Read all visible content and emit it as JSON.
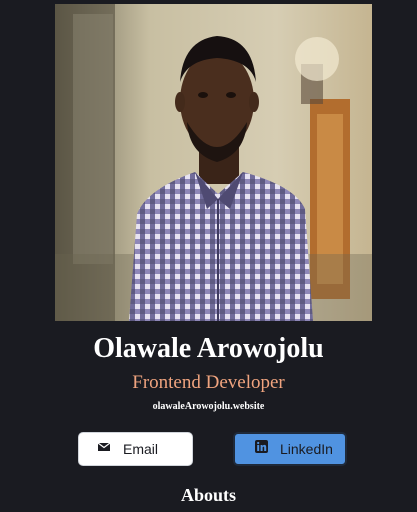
{
  "profile": {
    "photo_alt": "Portrait photo",
    "name": "Olawale Arowojolu",
    "role": "Frontend Developer",
    "website": "olawaleArowojolu.website"
  },
  "buttons": {
    "email": {
      "label": "Email",
      "icon": "envelope-icon"
    },
    "linkedin": {
      "label": "LinkedIn",
      "icon": "linkedin-icon"
    }
  },
  "sections": {
    "abouts_heading": "Abouts"
  },
  "colors": {
    "background": "#1a1b21",
    "role_text": "#f0a47f",
    "email_button": "#ffffff",
    "linkedin_button": "#5093e1"
  }
}
